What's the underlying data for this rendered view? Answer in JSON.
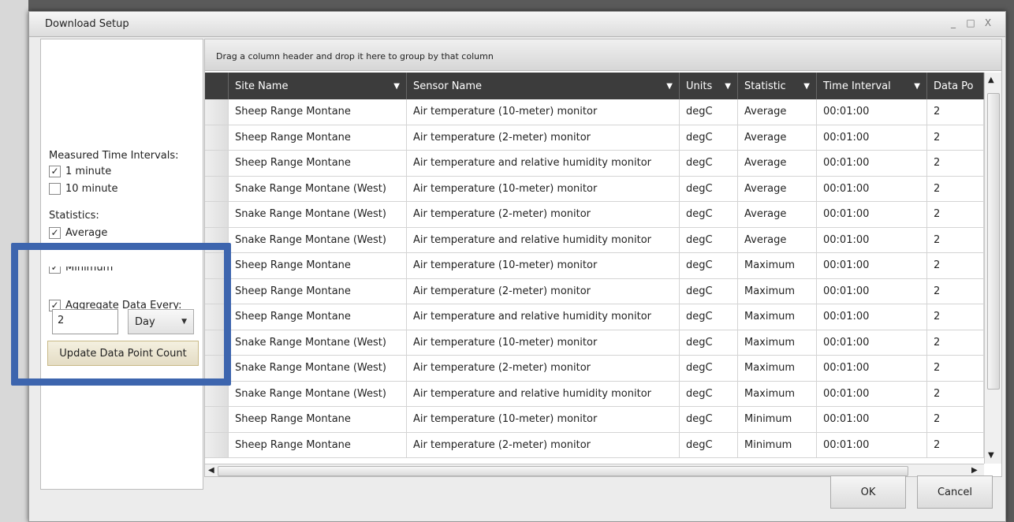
{
  "dialog": {
    "title": "Download Setup",
    "window_controls": [
      "_",
      "□",
      "X"
    ]
  },
  "left_pane": {
    "intervals_label": "Measured Time Intervals:",
    "intervals": [
      {
        "label": "1 minute",
        "checked": true
      },
      {
        "label": "10 minute",
        "checked": false
      }
    ],
    "statistics_label": "Statistics:",
    "statistics": [
      {
        "label": "Average",
        "checked": true
      },
      {
        "label": "Minimum",
        "checked": true
      }
    ],
    "aggregate": {
      "label": "Aggregate Data Every:",
      "checked": true
    },
    "aggregate_value": "2",
    "aggregate_unit": "Day",
    "update_button": "Update Data Point Count"
  },
  "grid": {
    "group_panel_text": "Drag a column header and drop it here to group by that column",
    "columns": [
      "Site Name",
      "Sensor Name",
      "Units",
      "Statistic",
      "Time Interval",
      "Data Po"
    ],
    "rows": [
      [
        "Sheep Range Montane",
        "Air temperature (10-meter) monitor",
        "degC",
        "Average",
        "00:01:00",
        "2"
      ],
      [
        "Sheep Range Montane",
        "Air temperature (2-meter) monitor",
        "degC",
        "Average",
        "00:01:00",
        "2"
      ],
      [
        "Sheep Range Montane",
        "Air temperature and relative humidity monitor",
        "degC",
        "Average",
        "00:01:00",
        "2"
      ],
      [
        "Snake Range Montane (West)",
        "Air temperature (10-meter) monitor",
        "degC",
        "Average",
        "00:01:00",
        "2"
      ],
      [
        "Snake Range Montane (West)",
        "Air temperature (2-meter) monitor",
        "degC",
        "Average",
        "00:01:00",
        "2"
      ],
      [
        "Snake Range Montane (West)",
        "Air temperature and relative humidity monitor",
        "degC",
        "Average",
        "00:01:00",
        "2"
      ],
      [
        "Sheep Range Montane",
        "Air temperature (10-meter) monitor",
        "degC",
        "Maximum",
        "00:01:00",
        "2"
      ],
      [
        "Sheep Range Montane",
        "Air temperature (2-meter) monitor",
        "degC",
        "Maximum",
        "00:01:00",
        "2"
      ],
      [
        "Sheep Range Montane",
        "Air temperature and relative humidity monitor",
        "degC",
        "Maximum",
        "00:01:00",
        "2"
      ],
      [
        "Snake Range Montane (West)",
        "Air temperature (10-meter) monitor",
        "degC",
        "Maximum",
        "00:01:00",
        "2"
      ],
      [
        "Snake Range Montane (West)",
        "Air temperature (2-meter) monitor",
        "degC",
        "Maximum",
        "00:01:00",
        "2"
      ],
      [
        "Snake Range Montane (West)",
        "Air temperature and relative humidity monitor",
        "degC",
        "Maximum",
        "00:01:00",
        "2"
      ],
      [
        "Sheep Range Montane",
        "Air temperature (10-meter) monitor",
        "degC",
        "Minimum",
        "00:01:00",
        "2"
      ],
      [
        "Sheep Range Montane",
        "Air temperature (2-meter) monitor",
        "degC",
        "Minimum",
        "00:01:00",
        "2"
      ]
    ]
  },
  "buttons": {
    "ok": "OK",
    "cancel": "Cancel"
  },
  "colors": {
    "highlight": "#3d65ae",
    "header": "#3c3c3c",
    "update_button": "#e4dcc4"
  },
  "icons": {
    "filter": "filter-icon",
    "checkbox": "check-icon",
    "dropdown": "chevron-down-icon"
  }
}
